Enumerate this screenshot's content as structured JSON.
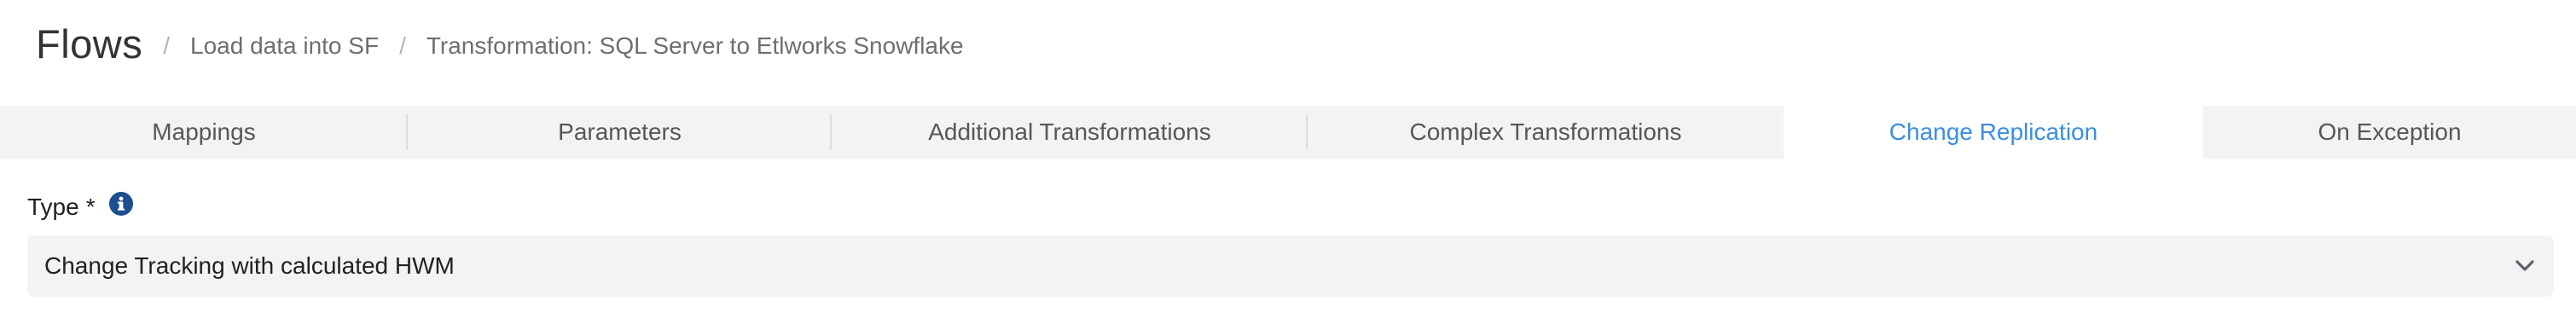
{
  "header": {
    "title": "Flows",
    "separator": "/",
    "breadcrumbs": [
      "Load data into SF",
      "Transformation: SQL Server to Etlworks Snowflake"
    ]
  },
  "tabs": [
    {
      "label": "Mappings",
      "active": false
    },
    {
      "label": "Parameters",
      "active": false
    },
    {
      "label": "Additional Transformations",
      "active": false
    },
    {
      "label": "Complex Transformations",
      "active": false
    },
    {
      "label": "Change Replication",
      "active": true
    },
    {
      "label": "On Exception",
      "active": false
    }
  ],
  "form": {
    "type_field": {
      "label": "Type",
      "required_marker": "*",
      "info_icon": "info-circle-icon",
      "selected_value": "Change Tracking with calculated HWM",
      "dropdown_icon": "chevron-down-icon"
    }
  },
  "colors": {
    "tab_bar_background": "#f2f3f5",
    "active_tab_text": "#3b8de0",
    "info_icon": "#1d4e8f",
    "select_background": "#f2f3f5"
  }
}
